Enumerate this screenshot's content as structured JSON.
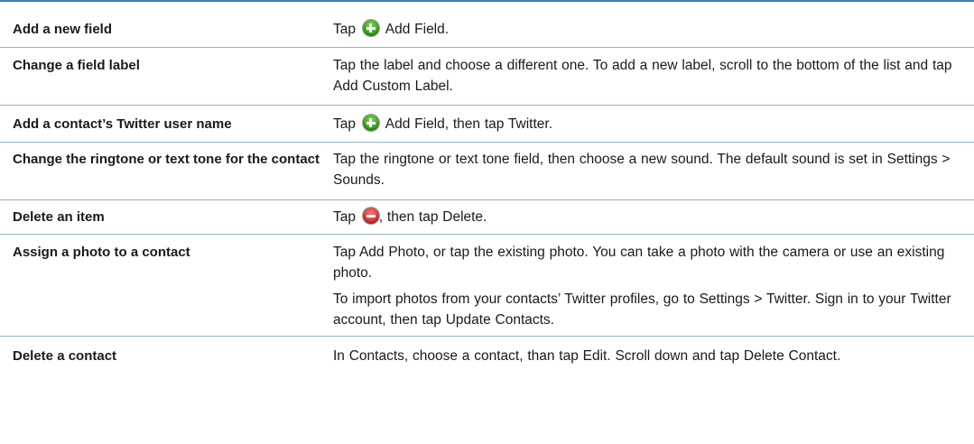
{
  "rows": [
    {
      "action": "Add a new field",
      "desc_pre": "Tap",
      "icon": "add-icon",
      "desc_post": "Add Field."
    },
    {
      "action": "Change a field label",
      "desc": "Tap the label and choose a different one. To add a new label, scroll to the bottom of the list and tap Add Custom Label."
    },
    {
      "action": "Add a contact’s Twitter user name",
      "desc_pre": "Tap",
      "icon": "add-icon",
      "desc_post": "Add Field, then tap Twitter."
    },
    {
      "action": "Change the ringtone or text tone for the contact",
      "desc": "Tap the ringtone or text tone field, then choose a new sound. The default sound is set in Settings > Sounds."
    },
    {
      "action": "Delete an item",
      "desc_pre": "Tap",
      "icon": "delete-icon",
      "desc_post": ", then tap Delete."
    },
    {
      "action": "Assign a photo to a contact",
      "desc": "Tap Add Photo, or tap the existing photo. You can take a photo with the camera or use an existing photo.",
      "desc2": "To import photos from your contacts’ Twitter profiles, go to Settings > Twitter. Sign in to your Twitter account, then tap Update Contacts."
    },
    {
      "action": "Delete a contact",
      "desc": "In Contacts, choose a contact, than tap Edit. Scroll down and tap Delete Contact."
    }
  ],
  "colors": {
    "top_rule": "#3d7fa6",
    "row_rule": "#8fb4cc",
    "add_icon": "#3ea624",
    "delete_icon": "#d63a3a"
  }
}
